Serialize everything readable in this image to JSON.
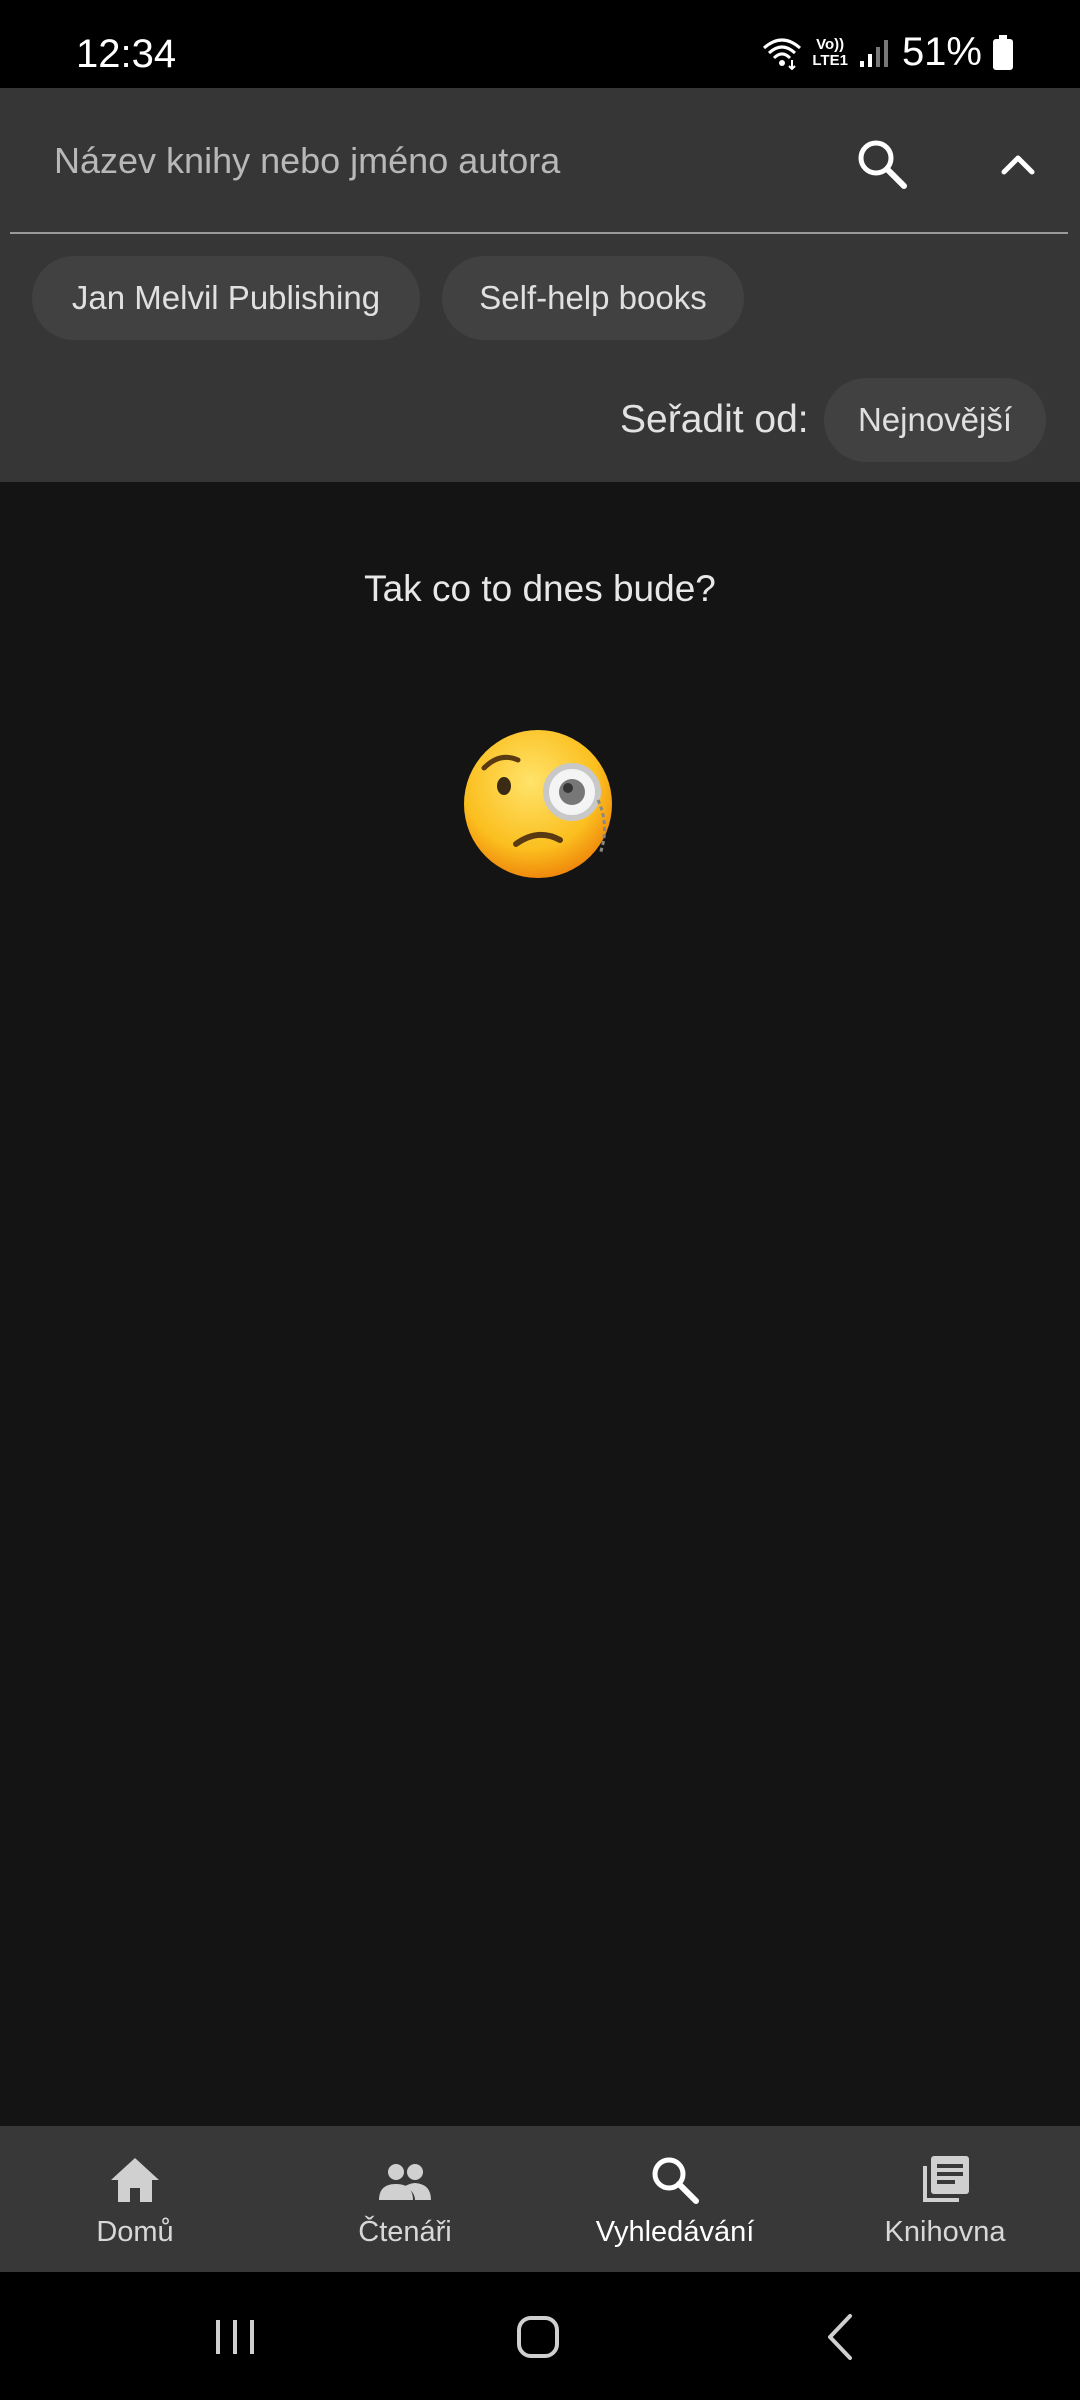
{
  "status_bar": {
    "time": "12:34",
    "network_label_top": "Vo))",
    "network_label_bottom": "LTE1",
    "battery": "51%"
  },
  "search": {
    "placeholder": "Název knihy nebo jméno autora",
    "search_icon": "search-icon",
    "collapse_icon": "chevron-up-icon"
  },
  "filters": {
    "chips": [
      "Jan Melvil Publishing",
      "Self-help books"
    ]
  },
  "sort": {
    "label": "Seřadit od:",
    "value": "Nejnovější"
  },
  "main": {
    "empty_title": "Tak co to dnes bude?",
    "emoji": "face-with-monocle-icon"
  },
  "bottom_nav": {
    "items": [
      {
        "label": "Domů",
        "icon": "home-icon"
      },
      {
        "label": "Čtenáři",
        "icon": "people-icon"
      },
      {
        "label": "Vyhledávání",
        "icon": "search-icon"
      },
      {
        "label": "Knihovna",
        "icon": "library-icon"
      }
    ],
    "active_index": 2
  },
  "system_nav": {
    "buttons": [
      "recents-icon",
      "home-button-icon",
      "back-icon"
    ]
  },
  "colors": {
    "background": "#141414",
    "header": "#363636",
    "chip": "#414141",
    "bottom_nav": "#383838"
  }
}
